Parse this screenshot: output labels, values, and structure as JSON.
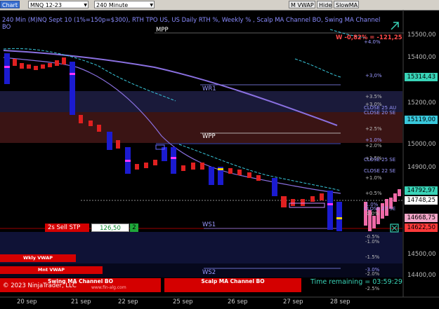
{
  "toolbar": {
    "chart_tab": "Chart",
    "instrument": "MNQ 12-23",
    "interval": "240 Minute",
    "buttons": [
      "M VWAP",
      "Hide",
      "SlowMA"
    ]
  },
  "chart": {
    "title": "240 Min (M)NQ Sept 10 (1%=150p=$300), RTH TPO US, US Daily RTH %, Weekly % , Scalp MA Channel BO, Swing MA Channel BO",
    "pnl": "W -0,82% = -121,25",
    "levels": [
      {
        "label": "MPP",
        "color": "#ffffff"
      },
      {
        "label": "WR1",
        "color": "#9a98ff"
      },
      {
        "label": "WPP",
        "color": "#ffffff"
      },
      {
        "label": "WS1",
        "color": "#9a98ff"
      },
      {
        "label": "WS2",
        "color": "#9a98ff"
      }
    ],
    "pct_labels": [
      {
        "text": "+4.0%",
        "color": "#9a98ff"
      },
      {
        "text": "+3,0%",
        "color": "#9a98ff"
      },
      {
        "text": "+3.5%",
        "color": "#bbbbbb"
      },
      {
        "text": "+3.0%",
        "color": "#bbbbbb"
      },
      {
        "text": "CLOSE 25 AU",
        "color": "#9a98ff"
      },
      {
        "text": "CLOSE 20 SE",
        "color": "#9a98ff"
      },
      {
        "text": "+2.5%",
        "color": "#bbbbbb"
      },
      {
        "text": "+1.0%",
        "color": "#9a98ff"
      },
      {
        "text": "+2.0%",
        "color": "#bbbbbb"
      },
      {
        "text": "+1.5%",
        "color": "#bbbbbb"
      },
      {
        "text": "CLOSE 25 SE",
        "color": "#9a98ff"
      },
      {
        "text": "CLOSE 22 SE",
        "color": "#9a98ff"
      },
      {
        "text": "+1.0%",
        "color": "#bbbbbb"
      },
      {
        "text": "+0.5%",
        "color": "#bbbbbb"
      },
      {
        "text": "-1.0%",
        "color": "#9a98ff"
      },
      {
        "text": "CLOSE 27 SE",
        "color": "#9a98ff"
      },
      {
        "text": "0.0%",
        "color": "#bbbbbb"
      },
      {
        "text": "-0.5%",
        "color": "#bbbbbb"
      },
      {
        "text": "-1.0%",
        "color": "#bbbbbb"
      },
      {
        "text": "-1.5%",
        "color": "#bbbbbb"
      },
      {
        "text": "-3.0%",
        "color": "#9a98ff"
      },
      {
        "text": "-2.0%",
        "color": "#bbbbbb"
      },
      {
        "text": "-2.5%",
        "color": "#bbbbbb"
      }
    ],
    "price_axis": [
      "15500,00",
      "15400,00",
      "15200,00",
      "15000,00",
      "14900,00",
      "14500,00",
      "14400,00"
    ],
    "price_tags": [
      {
        "text": "15314,43",
        "bg": "#39d4b8"
      },
      {
        "text": "15119,00",
        "bg": "#39c8dc"
      },
      {
        "text": "14792,97",
        "bg": "#39d4b8"
      },
      {
        "text": "14748,25",
        "bg": "#ffffff"
      },
      {
        "text": "14668,75",
        "bg": "#f3a6c8"
      },
      {
        "text": "14622,50",
        "bg": "#ff3a3a"
      }
    ],
    "order": {
      "label": "2s Sell STP",
      "price": "126,50",
      "qty": "2"
    },
    "dates": [
      "20 sep",
      "21 sep",
      "22 sep",
      "25 sep",
      "26 sep",
      "27 sep",
      "28 sep"
    ],
    "bars": {
      "wkly_vwap": "Wkly VWAP",
      "mnt_vwap": "Mnt VWAP",
      "swing": "Swing MA Channel BO",
      "scalp": "Scalp MA Channel BO"
    },
    "copyright": "© 2023 NinjaTrader, LLC",
    "watermark": "www.fin-alg.com",
    "time_remaining": "Time remaining = 03:59:29",
    "colors": {
      "bg": "#000000",
      "accent": "#8a8cff",
      "bear": "#e02020",
      "bull": "#1b1bd0"
    }
  }
}
